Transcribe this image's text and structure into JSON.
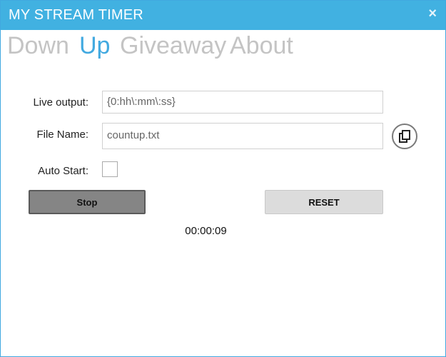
{
  "window": {
    "title": "MY STREAM TIMER",
    "close_icon": "×"
  },
  "tabs": [
    {
      "label": "Down",
      "active": false
    },
    {
      "label": "Up",
      "active": true
    },
    {
      "label": "Giveaway",
      "active": false
    },
    {
      "label": "About",
      "active": false
    }
  ],
  "form": {
    "live_output_label": "Live output:",
    "live_output_value": "{0:hh\\:mm\\:ss}",
    "file_name_label": "File Name:",
    "file_name_value": "countup.txt",
    "auto_start_label": "Auto Start:",
    "auto_start_checked": false
  },
  "buttons": {
    "stop_label": "Stop",
    "reset_label": "RESET"
  },
  "timer": {
    "display": "00:00:09"
  },
  "icons": {
    "close": "close-icon",
    "copy": "copy-icon"
  },
  "colors": {
    "accent": "#41b1e1",
    "inactive_tab": "#c4c4c4"
  }
}
